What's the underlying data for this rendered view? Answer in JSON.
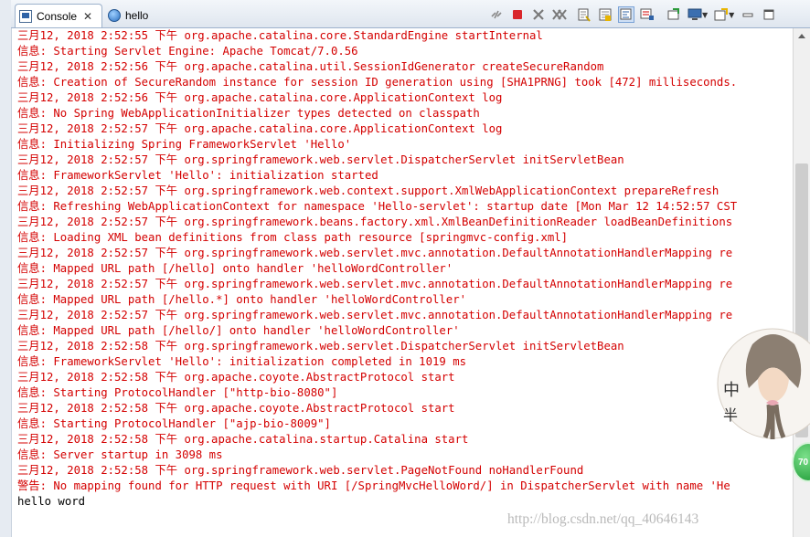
{
  "tabs": [
    {
      "label": "Console",
      "icon": "console-icon",
      "active": true
    },
    {
      "label": "hello",
      "icon": "globe-icon",
      "active": false
    }
  ],
  "toolbar": {
    "icons": [
      "disconnect-icon",
      "terminate-icon",
      "remove-launch-icon",
      "remove-all-terminated-icon",
      "clear-console-icon",
      "scroll-lock-icon",
      "word-wrap-icon",
      "show-on-output-icon",
      "pin-console-icon",
      "display-console-icon",
      "open-console-icon",
      "minimize-icon",
      "maximize-icon"
    ]
  },
  "console": {
    "lines": [
      {
        "text": "三月12, 2018 2:52:55 下午 org.apache.catalina.core.StandardEngine startInternal",
        "stream": "err"
      },
      {
        "text": "信息: Starting Servlet Engine: Apache Tomcat/7.0.56",
        "stream": "err"
      },
      {
        "text": "三月12, 2018 2:52:56 下午 org.apache.catalina.util.SessionIdGenerator createSecureRandom",
        "stream": "err"
      },
      {
        "text": "信息: Creation of SecureRandom instance for session ID generation using [SHA1PRNG] took [472] milliseconds.",
        "stream": "err"
      },
      {
        "text": "三月12, 2018 2:52:56 下午 org.apache.catalina.core.ApplicationContext log",
        "stream": "err"
      },
      {
        "text": "信息: No Spring WebApplicationInitializer types detected on classpath",
        "stream": "err"
      },
      {
        "text": "三月12, 2018 2:52:57 下午 org.apache.catalina.core.ApplicationContext log",
        "stream": "err"
      },
      {
        "text": "信息: Initializing Spring FrameworkServlet 'Hello'",
        "stream": "err"
      },
      {
        "text": "三月12, 2018 2:52:57 下午 org.springframework.web.servlet.DispatcherServlet initServletBean",
        "stream": "err"
      },
      {
        "text": "信息: FrameworkServlet 'Hello': initialization started",
        "stream": "err"
      },
      {
        "text": "三月12, 2018 2:52:57 下午 org.springframework.web.context.support.XmlWebApplicationContext prepareRefresh",
        "stream": "err"
      },
      {
        "text": "信息: Refreshing WebApplicationContext for namespace 'Hello-servlet': startup date [Mon Mar 12 14:52:57 CST",
        "stream": "err"
      },
      {
        "text": "三月12, 2018 2:52:57 下午 org.springframework.beans.factory.xml.XmlBeanDefinitionReader loadBeanDefinitions",
        "stream": "err"
      },
      {
        "text": "信息: Loading XML bean definitions from class path resource [springmvc-config.xml]",
        "stream": "err"
      },
      {
        "text": "三月12, 2018 2:52:57 下午 org.springframework.web.servlet.mvc.annotation.DefaultAnnotationHandlerMapping re",
        "stream": "err"
      },
      {
        "text": "信息: Mapped URL path [/hello] onto handler 'helloWordController'",
        "stream": "err"
      },
      {
        "text": "三月12, 2018 2:52:57 下午 org.springframework.web.servlet.mvc.annotation.DefaultAnnotationHandlerMapping re",
        "stream": "err"
      },
      {
        "text": "信息: Mapped URL path [/hello.*] onto handler 'helloWordController'",
        "stream": "err"
      },
      {
        "text": "三月12, 2018 2:52:57 下午 org.springframework.web.servlet.mvc.annotation.DefaultAnnotationHandlerMapping re",
        "stream": "err"
      },
      {
        "text": "信息: Mapped URL path [/hello/] onto handler 'helloWordController'",
        "stream": "err"
      },
      {
        "text": "三月12, 2018 2:52:58 下午 org.springframework.web.servlet.DispatcherServlet initServletBean",
        "stream": "err"
      },
      {
        "text": "信息: FrameworkServlet 'Hello': initialization completed in 1019 ms",
        "stream": "err"
      },
      {
        "text": "三月12, 2018 2:52:58 下午 org.apache.coyote.AbstractProtocol start",
        "stream": "err"
      },
      {
        "text": "信息: Starting ProtocolHandler [\"http-bio-8080\"]",
        "stream": "err"
      },
      {
        "text": "三月12, 2018 2:52:58 下午 org.apache.coyote.AbstractProtocol start",
        "stream": "err"
      },
      {
        "text": "信息: Starting ProtocolHandler [\"ajp-bio-8009\"]",
        "stream": "err"
      },
      {
        "text": "三月12, 2018 2:52:58 下午 org.apache.catalina.startup.Catalina start",
        "stream": "err"
      },
      {
        "text": "信息: Server startup in 3098 ms",
        "stream": "err"
      },
      {
        "text": "三月12, 2018 2:52:58 下午 org.springframework.web.servlet.PageNotFound noHandlerFound",
        "stream": "err"
      },
      {
        "text": "警告: No mapping found for HTTP request with URI [/SpringMvcHelloWord/] in DispatcherServlet with name 'He",
        "stream": "err"
      },
      {
        "text": "hello word",
        "stream": "out"
      }
    ]
  },
  "overlay": {
    "avatar_text": [
      "中",
      "半"
    ],
    "badge_text": "70",
    "watermark": "http://blog.csdn.net/qq_40646143"
  },
  "colors": {
    "stderr": "#d40000",
    "stdout": "#000000",
    "badge": "#1e9b36"
  }
}
